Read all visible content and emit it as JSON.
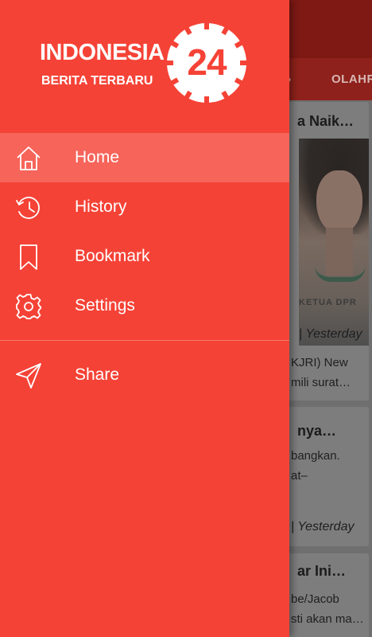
{
  "brand": {
    "name": "INDONESIA",
    "tagline": "BERITA TERBARU",
    "badge_number": "24"
  },
  "menu": {
    "items": [
      {
        "label": "Home",
        "icon": "home-icon",
        "active": true
      },
      {
        "label": "History",
        "icon": "history-icon",
        "active": false
      },
      {
        "label": "Bookmark",
        "icon": "bookmark-icon",
        "active": false
      },
      {
        "label": "Settings",
        "icon": "gear-icon",
        "active": false
      }
    ],
    "share": {
      "label": "Share",
      "icon": "send-icon"
    }
  },
  "background": {
    "tabs": [
      "»",
      "OLAHR"
    ],
    "cards": [
      {
        "title": "a Naik…",
        "image_caption": "KETUA DPR",
        "time": "| Yesterday",
        "lines": [
          "KJRI) New",
          "mili surat…"
        ]
      },
      {
        "title": "nya…",
        "lines": [
          "bangkan.",
          "at–"
        ],
        "time": "| Yesterday"
      },
      {
        "title": "ar Ini…",
        "lines": [
          "be/Jacob",
          "sti akan ma…"
        ]
      }
    ]
  },
  "colors": {
    "drawer": "#f54236",
    "active_item": "#f6645a",
    "text": "#ffffff",
    "scrim_toolbar": "#7e1914"
  }
}
